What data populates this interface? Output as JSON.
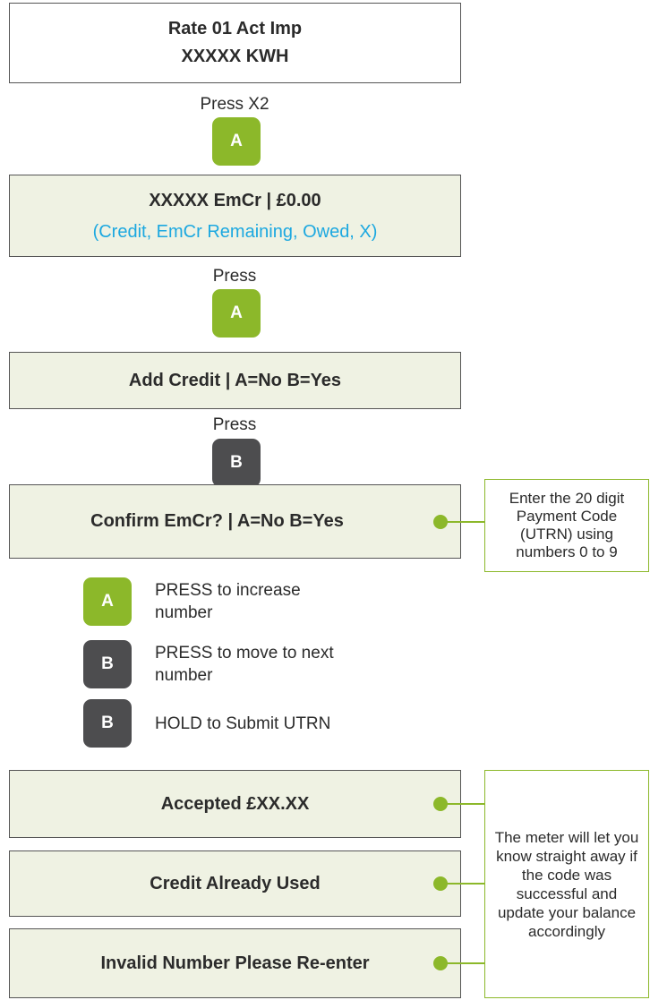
{
  "steps": [
    {
      "line1": "Rate 01 Act Imp",
      "line2": "XXXXX KWH"
    },
    {
      "press_label": "Press X2",
      "button": "A"
    },
    {
      "line1": "XXXXX EmCr  |  £0.00",
      "line2": "(Credit, EmCr Remaining, Owed, X)"
    },
    {
      "press_label": "Press",
      "button": "A"
    },
    {
      "line1": "Add Credit  |  A=No B=Yes"
    },
    {
      "press_label": "Press",
      "button": "B"
    },
    {
      "line1": "Confirm EmCr?  |  A=No B=Yes"
    }
  ],
  "legend": [
    {
      "button": "A",
      "text": "PRESS to increase number"
    },
    {
      "button": "B",
      "text": "PRESS to move to next number"
    },
    {
      "button": "B",
      "text": "HOLD to Submit UTRN"
    }
  ],
  "results": [
    {
      "text": "Accepted £XX.XX"
    },
    {
      "text": "Credit Already Used"
    },
    {
      "text": "Invalid Number Please Re-enter"
    }
  ],
  "notes": {
    "utrn": "Enter the 20 digit Payment Code (UTRN) using numbers 0 to 9",
    "result": "The meter will let you know straight away if the code was successful and update your balance accordingly"
  },
  "colors": {
    "green_button": "#8cb82a",
    "dark_button": "#4d4d4f",
    "box_fill": "#eff2e3",
    "secondary_text": "#1ca8e0",
    "connector": "#8cb82a"
  }
}
